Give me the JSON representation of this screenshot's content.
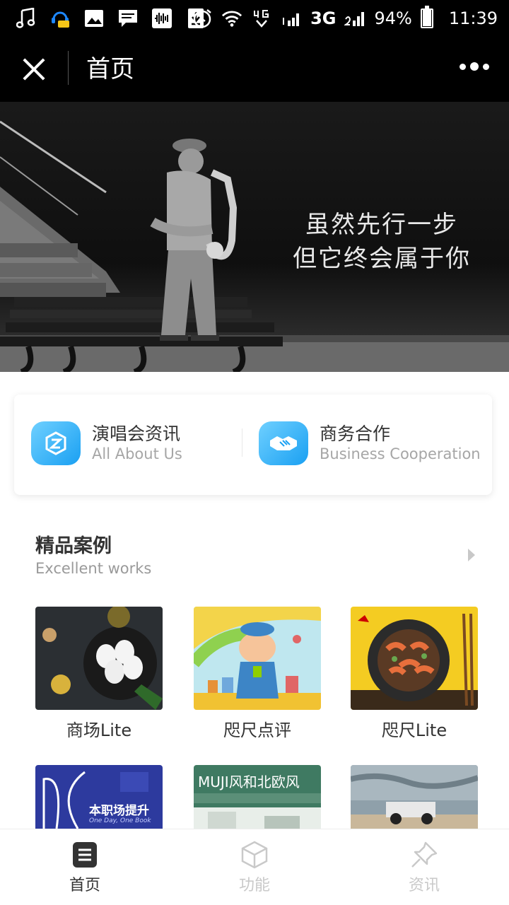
{
  "status_bar": {
    "network": "3G",
    "battery": "94%",
    "battery_level": 0.94,
    "time": "11:39"
  },
  "nav": {
    "title": "首页"
  },
  "banner": {
    "line1": "虽然先行一步",
    "line2": "但它终会属于你"
  },
  "quick_links": [
    {
      "title": "演唱会资讯",
      "subtitle": "All About Us",
      "icon": "z-logo-icon"
    },
    {
      "title": "商务合作",
      "subtitle": "Business Cooperation",
      "icon": "handshake-icon"
    }
  ],
  "section": {
    "title": "精品案例",
    "subtitle": "Excellent works"
  },
  "cases": [
    {
      "label": "商场Lite"
    },
    {
      "label": "咫尺点评"
    },
    {
      "label": "咫尺Lite"
    }
  ],
  "cases_row2": [
    {
      "overlay": "本职场提升",
      "overlay_sub": "One Day, One Book"
    },
    {
      "overlay": "MUJI风和北欧风"
    },
    {
      "overlay": ""
    }
  ],
  "tabs": [
    {
      "label": "首页",
      "icon": "document-icon",
      "active": true
    },
    {
      "label": "功能",
      "icon": "cube-icon",
      "active": false
    },
    {
      "label": "资讯",
      "icon": "pin-icon",
      "active": false
    }
  ],
  "colors": {
    "accent": "#1aa0f2",
    "topbar": "#000000",
    "inactive_tab": "#c9c9c9"
  }
}
